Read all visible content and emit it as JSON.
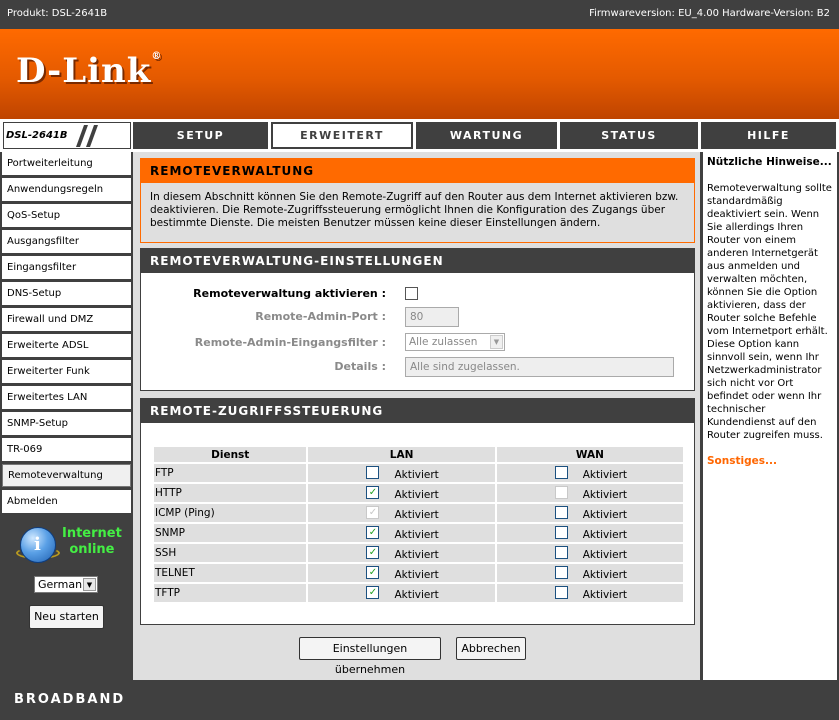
{
  "topbar": {
    "product": "Produkt: DSL-2641B",
    "firmware": "Firmwareversion: EU_4.00 Hardware-Version: B2"
  },
  "banner": {
    "logo": "D-Link",
    "logo_mark": "®"
  },
  "nav": {
    "model": "DSL-2641B",
    "tabs": [
      {
        "label": "SETUP"
      },
      {
        "label": "ERWEITERT"
      },
      {
        "label": "WARTUNG"
      },
      {
        "label": "STATUS"
      },
      {
        "label": "HILFE"
      }
    ],
    "active_tab": "ERWEITERT"
  },
  "sidebar": {
    "items": [
      {
        "label": "Portweiterleitung"
      },
      {
        "label": "Anwendungsregeln"
      },
      {
        "label": "QoS-Setup"
      },
      {
        "label": "Ausgangsfilter"
      },
      {
        "label": "Eingangsfilter"
      },
      {
        "label": "DNS-Setup"
      },
      {
        "label": "Firewall und DMZ"
      },
      {
        "label": "Erweiterte ADSL"
      },
      {
        "label": "Erweiterter Funk"
      },
      {
        "label": "Erweitertes LAN"
      },
      {
        "label": "SNMP-Setup"
      },
      {
        "label": "TR-069"
      },
      {
        "label": "Remoteverwaltung"
      },
      {
        "label": "Abmelden"
      }
    ],
    "active_item": "Remoteverwaltung",
    "internet_status_line1": "Internet",
    "internet_status_line2": "online",
    "language": "German",
    "restart_label": "Neu starten"
  },
  "main": {
    "intro": {
      "title": "REMOTEVERWALTUNG",
      "text": "In diesem Abschnitt können Sie den Remote-Zugriff auf den Router aus dem Internet aktivieren bzw. deaktivieren. Die Remote-Zugriffssteuerung ermöglicht Ihnen die Konfiguration des Zugangs über bestimmte Dienste. Die meisten Benutzer müssen keine dieser Einstellungen ändern."
    },
    "settings": {
      "title": "REMOTEVERWALTUNG-EINSTELLUNGEN",
      "enable_label": "Remoteverwaltung aktivieren :",
      "enable_checked": false,
      "port_label": "Remote-Admin-Port :",
      "port_value": "80",
      "filter_label": "Remote-Admin-Eingangsfilter :",
      "filter_value": "Alle zulassen",
      "details_label": "Details :",
      "details_value": "Alle sind zugelassen."
    },
    "access": {
      "title": "REMOTE-ZUGRIFFSSTEUERUNG",
      "headers": {
        "service": "Dienst",
        "lan": "LAN",
        "wan": "WAN"
      },
      "rows": [
        {
          "service": "FTP",
          "lan_label": "Aktiviert",
          "wan_label": "Aktiviert"
        },
        {
          "service": "HTTP",
          "lan_label": "Aktiviert",
          "wan_label": "Aktiviert"
        },
        {
          "service": "ICMP (Ping)",
          "lan_label": "Aktiviert",
          "wan_label": "Aktiviert"
        },
        {
          "service": "SNMP",
          "lan_label": "Aktiviert",
          "wan_label": "Aktiviert"
        },
        {
          "service": "SSH",
          "lan_label": "Aktiviert",
          "wan_label": "Aktiviert"
        },
        {
          "service": "TELNET",
          "lan_label": "Aktiviert",
          "wan_label": "Aktiviert"
        },
        {
          "service": "TFTP",
          "lan_label": "Aktiviert",
          "wan_label": "Aktiviert"
        }
      ],
      "states": {
        "lan_checked": [
          false,
          true,
          true,
          true,
          true,
          true,
          true
        ],
        "lan_disabled": [
          false,
          false,
          true,
          false,
          false,
          false,
          false
        ],
        "wan_checked": [
          false,
          false,
          false,
          false,
          false,
          false,
          false
        ],
        "wan_disabled": [
          false,
          true,
          false,
          false,
          false,
          false,
          false
        ]
      }
    },
    "buttons": {
      "apply": "Einstellungen übernehmen",
      "cancel": "Abbrechen"
    }
  },
  "hints": {
    "title": "Nützliche Hinweise...",
    "body": "Remoteverwaltung sollte standardmäßig deaktiviert sein. Wenn Sie allerdings Ihren Router von einem anderen Internetgerät aus anmelden und verwalten möchten, können Sie die Option aktivieren, dass der Router solche Befehle vom Internetport erhält. Diese Option kann sinnvoll sein, wenn Ihr Netzwerkadministrator sich nicht vor Ort befindet oder wenn Ihr technischer Kundendienst auf den Router zugreifen muss.",
    "more": "Sonstiges..."
  },
  "footer": {
    "brand": "BROADBAND"
  },
  "colors": {
    "accent": "#ff6a00",
    "dark": "#404040",
    "panel": "#dfdfdf",
    "online": "#44ee44",
    "hint_link": "#ff6600"
  }
}
